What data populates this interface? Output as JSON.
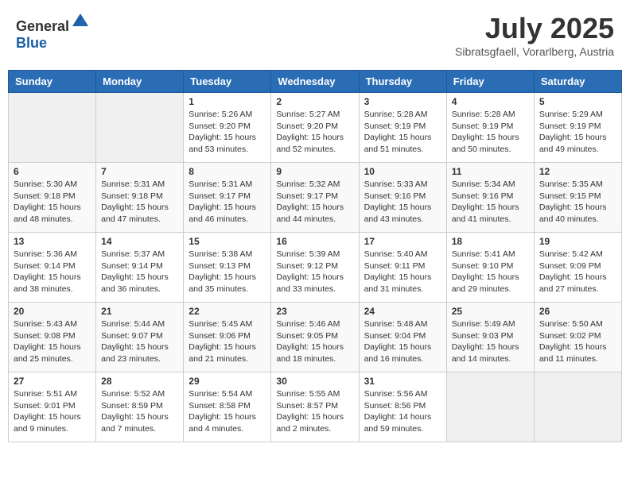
{
  "header": {
    "logo": {
      "general": "General",
      "blue": "Blue"
    },
    "title": "July 2025",
    "location": "Sibratsgfaell, Vorarlberg, Austria"
  },
  "calendar": {
    "days_of_week": [
      "Sunday",
      "Monday",
      "Tuesday",
      "Wednesday",
      "Thursday",
      "Friday",
      "Saturday"
    ],
    "weeks": [
      [
        {
          "day": "",
          "sunrise": "",
          "sunset": "",
          "daylight": ""
        },
        {
          "day": "",
          "sunrise": "",
          "sunset": "",
          "daylight": ""
        },
        {
          "day": "1",
          "sunrise": "Sunrise: 5:26 AM",
          "sunset": "Sunset: 9:20 PM",
          "daylight": "Daylight: 15 hours and 53 minutes."
        },
        {
          "day": "2",
          "sunrise": "Sunrise: 5:27 AM",
          "sunset": "Sunset: 9:20 PM",
          "daylight": "Daylight: 15 hours and 52 minutes."
        },
        {
          "day": "3",
          "sunrise": "Sunrise: 5:28 AM",
          "sunset": "Sunset: 9:19 PM",
          "daylight": "Daylight: 15 hours and 51 minutes."
        },
        {
          "day": "4",
          "sunrise": "Sunrise: 5:28 AM",
          "sunset": "Sunset: 9:19 PM",
          "daylight": "Daylight: 15 hours and 50 minutes."
        },
        {
          "day": "5",
          "sunrise": "Sunrise: 5:29 AM",
          "sunset": "Sunset: 9:19 PM",
          "daylight": "Daylight: 15 hours and 49 minutes."
        }
      ],
      [
        {
          "day": "6",
          "sunrise": "Sunrise: 5:30 AM",
          "sunset": "Sunset: 9:18 PM",
          "daylight": "Daylight: 15 hours and 48 minutes."
        },
        {
          "day": "7",
          "sunrise": "Sunrise: 5:31 AM",
          "sunset": "Sunset: 9:18 PM",
          "daylight": "Daylight: 15 hours and 47 minutes."
        },
        {
          "day": "8",
          "sunrise": "Sunrise: 5:31 AM",
          "sunset": "Sunset: 9:17 PM",
          "daylight": "Daylight: 15 hours and 46 minutes."
        },
        {
          "day": "9",
          "sunrise": "Sunrise: 5:32 AM",
          "sunset": "Sunset: 9:17 PM",
          "daylight": "Daylight: 15 hours and 44 minutes."
        },
        {
          "day": "10",
          "sunrise": "Sunrise: 5:33 AM",
          "sunset": "Sunset: 9:16 PM",
          "daylight": "Daylight: 15 hours and 43 minutes."
        },
        {
          "day": "11",
          "sunrise": "Sunrise: 5:34 AM",
          "sunset": "Sunset: 9:16 PM",
          "daylight": "Daylight: 15 hours and 41 minutes."
        },
        {
          "day": "12",
          "sunrise": "Sunrise: 5:35 AM",
          "sunset": "Sunset: 9:15 PM",
          "daylight": "Daylight: 15 hours and 40 minutes."
        }
      ],
      [
        {
          "day": "13",
          "sunrise": "Sunrise: 5:36 AM",
          "sunset": "Sunset: 9:14 PM",
          "daylight": "Daylight: 15 hours and 38 minutes."
        },
        {
          "day": "14",
          "sunrise": "Sunrise: 5:37 AM",
          "sunset": "Sunset: 9:14 PM",
          "daylight": "Daylight: 15 hours and 36 minutes."
        },
        {
          "day": "15",
          "sunrise": "Sunrise: 5:38 AM",
          "sunset": "Sunset: 9:13 PM",
          "daylight": "Daylight: 15 hours and 35 minutes."
        },
        {
          "day": "16",
          "sunrise": "Sunrise: 5:39 AM",
          "sunset": "Sunset: 9:12 PM",
          "daylight": "Daylight: 15 hours and 33 minutes."
        },
        {
          "day": "17",
          "sunrise": "Sunrise: 5:40 AM",
          "sunset": "Sunset: 9:11 PM",
          "daylight": "Daylight: 15 hours and 31 minutes."
        },
        {
          "day": "18",
          "sunrise": "Sunrise: 5:41 AM",
          "sunset": "Sunset: 9:10 PM",
          "daylight": "Daylight: 15 hours and 29 minutes."
        },
        {
          "day": "19",
          "sunrise": "Sunrise: 5:42 AM",
          "sunset": "Sunset: 9:09 PM",
          "daylight": "Daylight: 15 hours and 27 minutes."
        }
      ],
      [
        {
          "day": "20",
          "sunrise": "Sunrise: 5:43 AM",
          "sunset": "Sunset: 9:08 PM",
          "daylight": "Daylight: 15 hours and 25 minutes."
        },
        {
          "day": "21",
          "sunrise": "Sunrise: 5:44 AM",
          "sunset": "Sunset: 9:07 PM",
          "daylight": "Daylight: 15 hours and 23 minutes."
        },
        {
          "day": "22",
          "sunrise": "Sunrise: 5:45 AM",
          "sunset": "Sunset: 9:06 PM",
          "daylight": "Daylight: 15 hours and 21 minutes."
        },
        {
          "day": "23",
          "sunrise": "Sunrise: 5:46 AM",
          "sunset": "Sunset: 9:05 PM",
          "daylight": "Daylight: 15 hours and 18 minutes."
        },
        {
          "day": "24",
          "sunrise": "Sunrise: 5:48 AM",
          "sunset": "Sunset: 9:04 PM",
          "daylight": "Daylight: 15 hours and 16 minutes."
        },
        {
          "day": "25",
          "sunrise": "Sunrise: 5:49 AM",
          "sunset": "Sunset: 9:03 PM",
          "daylight": "Daylight: 15 hours and 14 minutes."
        },
        {
          "day": "26",
          "sunrise": "Sunrise: 5:50 AM",
          "sunset": "Sunset: 9:02 PM",
          "daylight": "Daylight: 15 hours and 11 minutes."
        }
      ],
      [
        {
          "day": "27",
          "sunrise": "Sunrise: 5:51 AM",
          "sunset": "Sunset: 9:01 PM",
          "daylight": "Daylight: 15 hours and 9 minutes."
        },
        {
          "day": "28",
          "sunrise": "Sunrise: 5:52 AM",
          "sunset": "Sunset: 8:59 PM",
          "daylight": "Daylight: 15 hours and 7 minutes."
        },
        {
          "day": "29",
          "sunrise": "Sunrise: 5:54 AM",
          "sunset": "Sunset: 8:58 PM",
          "daylight": "Daylight: 15 hours and 4 minutes."
        },
        {
          "day": "30",
          "sunrise": "Sunrise: 5:55 AM",
          "sunset": "Sunset: 8:57 PM",
          "daylight": "Daylight: 15 hours and 2 minutes."
        },
        {
          "day": "31",
          "sunrise": "Sunrise: 5:56 AM",
          "sunset": "Sunset: 8:56 PM",
          "daylight": "Daylight: 14 hours and 59 minutes."
        },
        {
          "day": "",
          "sunrise": "",
          "sunset": "",
          "daylight": ""
        },
        {
          "day": "",
          "sunrise": "",
          "sunset": "",
          "daylight": ""
        }
      ]
    ]
  }
}
